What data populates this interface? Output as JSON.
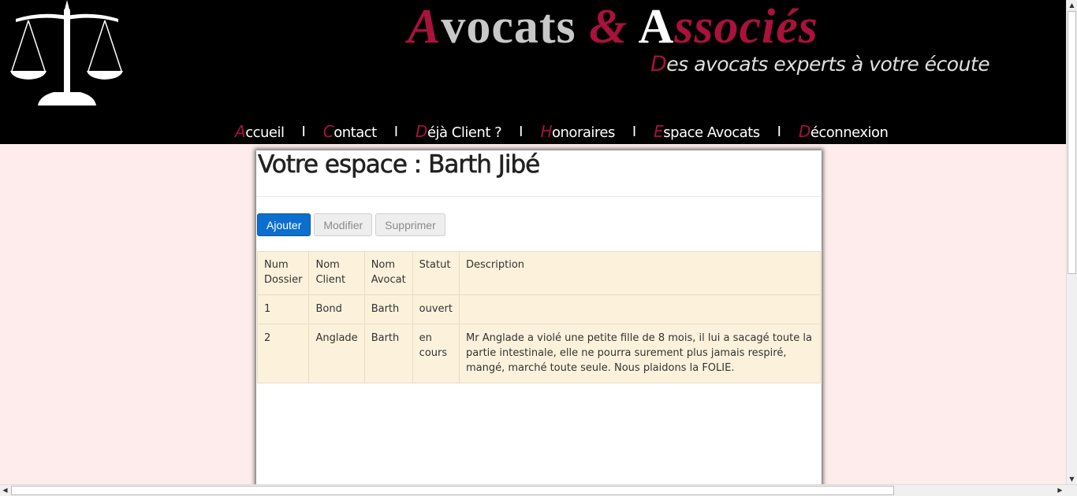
{
  "header": {
    "title": {
      "part1_initial": "A",
      "part1_rest": "vocats",
      "ampersand": "&",
      "part2_initial": "A",
      "part2_rest": "ssociés"
    },
    "tagline": {
      "initial": "D",
      "rest": "es avocats experts à votre écoute"
    },
    "logo_icon": "scales-of-justice-icon"
  },
  "nav": {
    "separator": "I",
    "items": [
      {
        "first": "A",
        "rest": "ccueil"
      },
      {
        "first": "C",
        "rest": "ontact"
      },
      {
        "first": "D",
        "rest": "éjà Client ?"
      },
      {
        "first": "H",
        "rest": "onoraires"
      },
      {
        "first": "E",
        "rest": "space Avocats"
      },
      {
        "first": "D",
        "rest": "éconnexion"
      }
    ]
  },
  "main": {
    "title": "Votre espace : Barth Jibé",
    "actions": {
      "add": "Ajouter",
      "edit": "Modifier",
      "delete": "Supprimer"
    },
    "table": {
      "headers": [
        "Num Dossier",
        "Nom Client",
        "Nom Avocat",
        "Statut",
        "Description"
      ],
      "rows": [
        [
          "1",
          "Bond",
          "Barth",
          "ouvert",
          ""
        ],
        [
          "2",
          "Anglade",
          "Barth",
          "en cours",
          "Mr Anglade a violé une petite fille de 8 mois, il lui a sacagé toute la partie intestinale, elle ne pourra surement plus jamais respiré, mangé, marché toute seule. Nous plaidons la FOLIE."
        ]
      ]
    }
  },
  "colors": {
    "accent": "#a8123b",
    "header_bg": "#000000",
    "page_bg": "#fdeceb",
    "table_bg": "#fcf2dc",
    "primary_button": "#0c6fcf"
  }
}
